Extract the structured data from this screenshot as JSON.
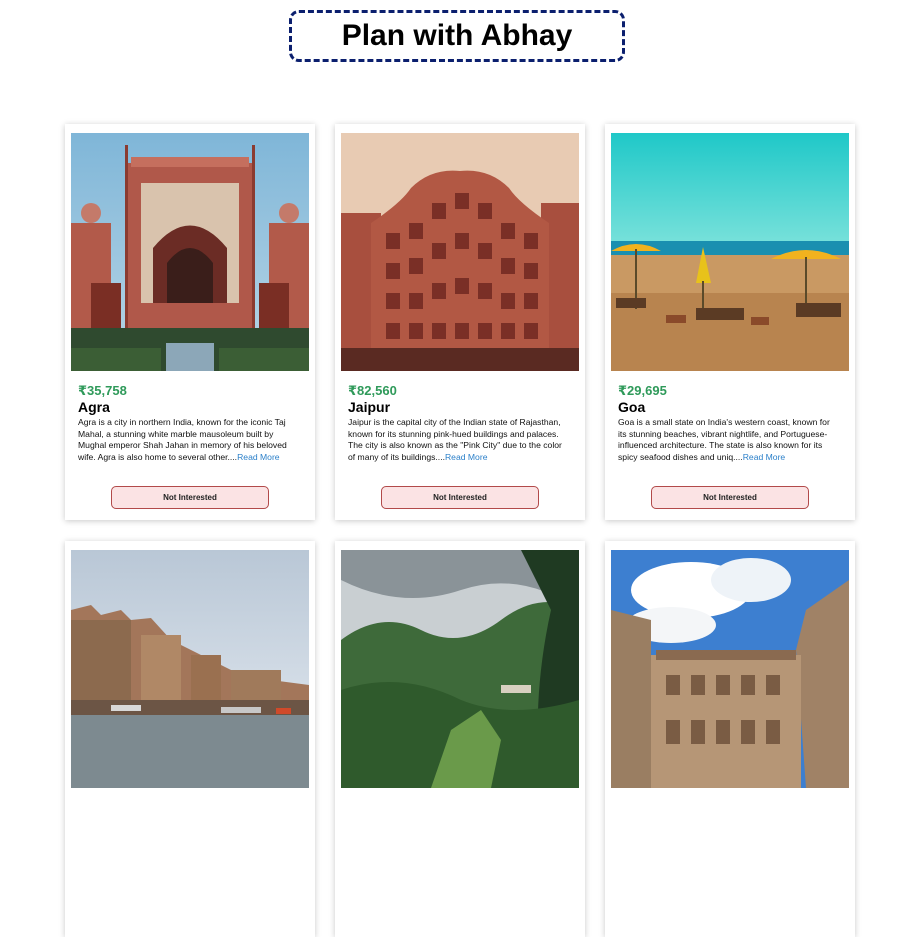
{
  "header": {
    "title": "Plan with Abhay"
  },
  "cards": [
    {
      "price": "₹35,758",
      "name": "Agra",
      "description": "Agra is a city in northern India, known for the iconic Taj Mahal, a stunning white marble mausoleum built by Mughal emperor Shah Jahan in memory of his beloved wife. Agra is also home to several other....",
      "read_more": "Read More",
      "button": "Not Interested",
      "image_icon": "red-fort-gate-photo"
    },
    {
      "price": "₹82,560",
      "name": "Jaipur",
      "description": "Jaipur is the capital city of the Indian state of Rajasthan, known for its stunning pink-hued buildings and palaces. The city is also known as the \"Pink City\" due to the color of many of its buildings....",
      "read_more": "Read More",
      "button": "Not Interested",
      "image_icon": "hawa-mahal-photo"
    },
    {
      "price": "₹29,695",
      "name": "Goa",
      "description": "Goa is a small state on India's western coast, known for its stunning beaches, vibrant nightlife, and Portuguese-influenced architecture. The state is also known for its spicy seafood dishes and uniq....",
      "read_more": "Read More",
      "button": "Not Interested",
      "image_icon": "beach-umbrellas-photo"
    },
    {
      "image_icon": "varanasi-ghats-photo"
    },
    {
      "image_icon": "misty-hills-photo"
    },
    {
      "image_icon": "fort-courtyard-photo"
    }
  ],
  "colors": {
    "price": "#2f9a5a",
    "link": "#2a7fc9",
    "button_bg": "#fbe3e4",
    "button_border": "#b24a4a",
    "title_border": "#0b1f6e"
  }
}
